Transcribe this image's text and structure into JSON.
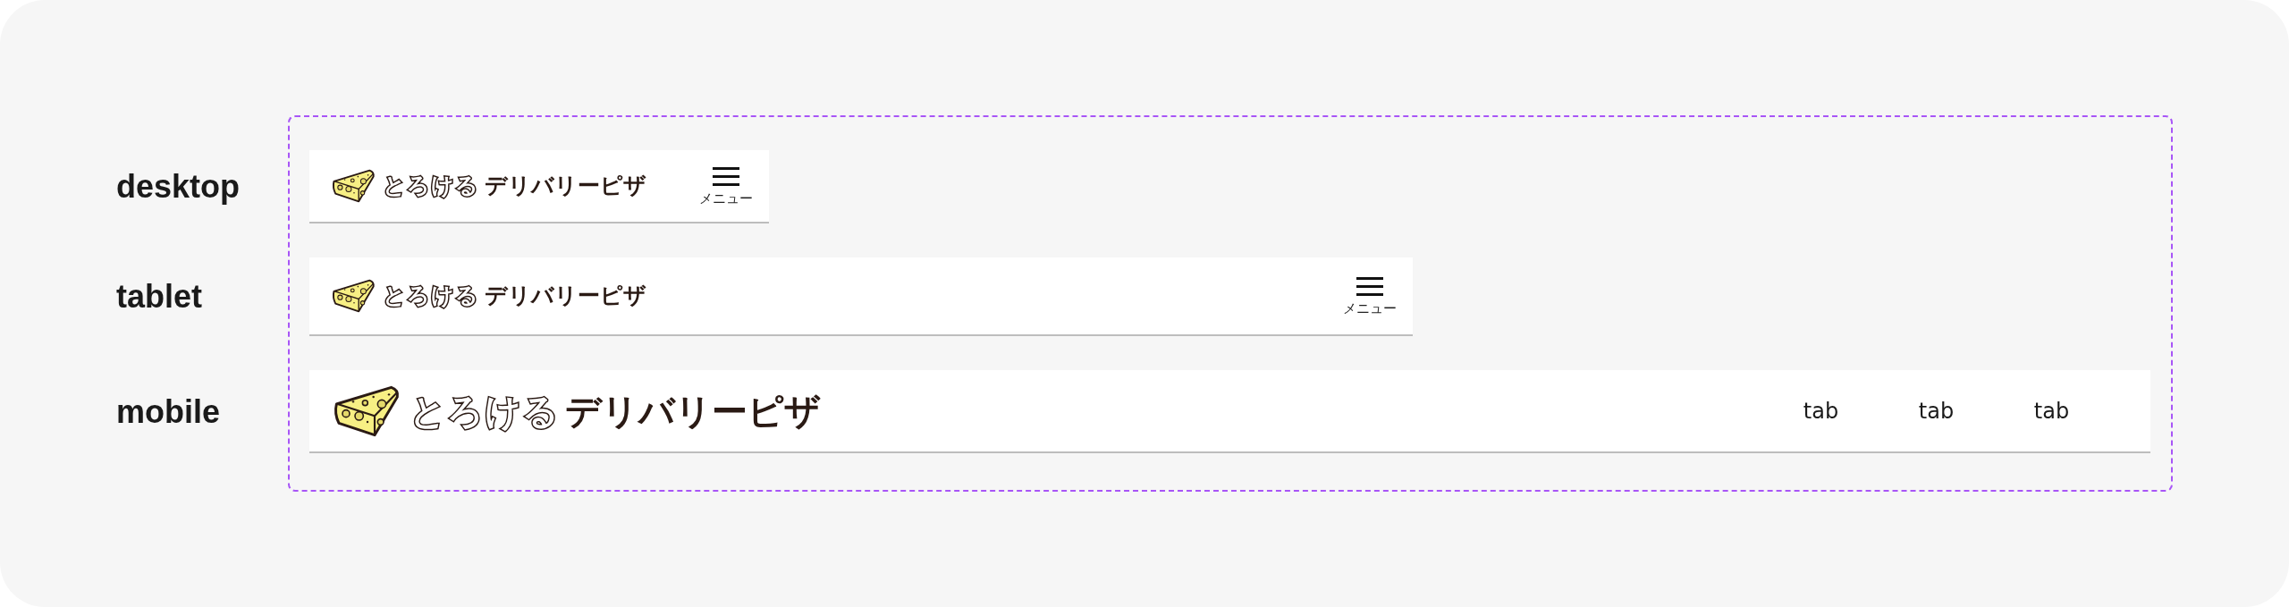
{
  "variants": [
    {
      "label": "desktop",
      "header": {
        "kind": "compact",
        "logo": {
          "light": "とろける",
          "dark": "デリバリーピザ"
        },
        "nav": {
          "kind": "menu",
          "label": "メニュー"
        }
      }
    },
    {
      "label": "tablet",
      "header": {
        "kind": "compact",
        "logo": {
          "light": "とろける",
          "dark": "デリバリーピザ"
        },
        "nav": {
          "kind": "menu",
          "label": "メニュー"
        }
      }
    },
    {
      "label": "mobile",
      "header": {
        "kind": "large",
        "logo": {
          "light": "とろける",
          "dark": "デリバリーピザ"
        },
        "nav": {
          "kind": "tabs",
          "tabs": [
            "tab",
            "tab",
            "tab"
          ]
        }
      }
    }
  ]
}
